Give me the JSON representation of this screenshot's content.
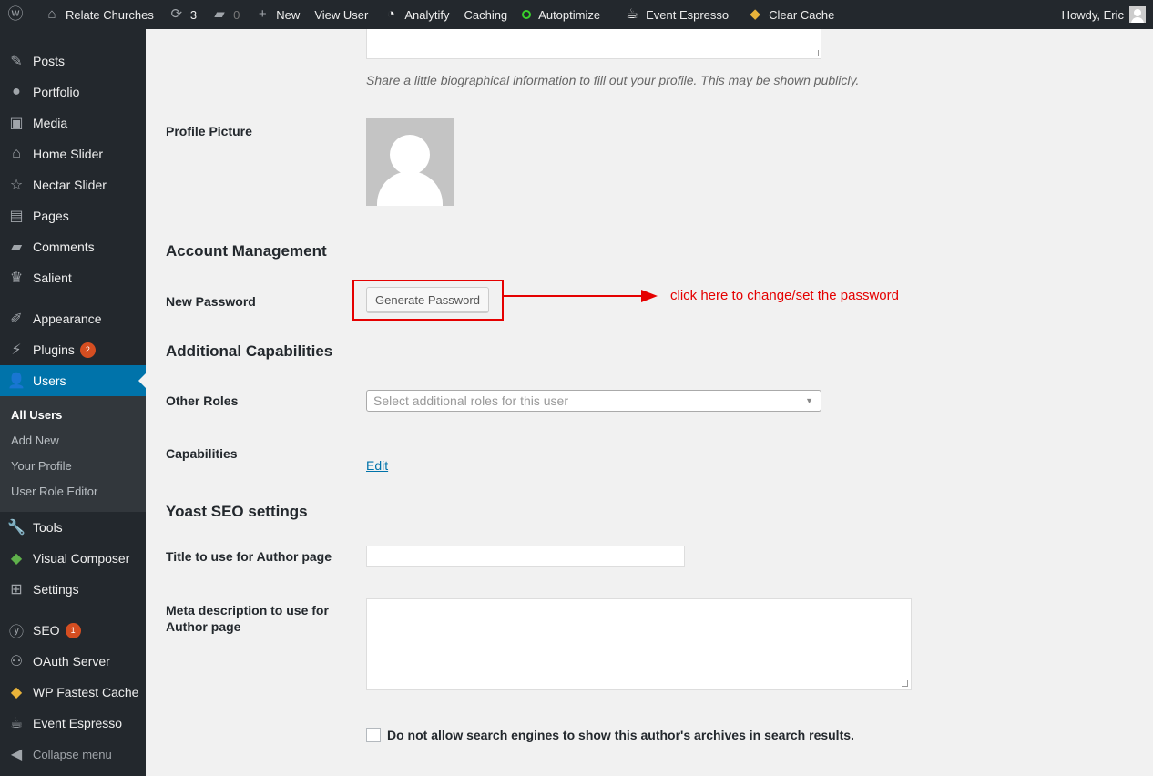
{
  "admin_bar": {
    "site_name": "Relate Churches",
    "updates_count": "3",
    "comments_count": "0",
    "new_label": "New",
    "view_user": "View User",
    "analytify": "Analytify",
    "caching": "Caching",
    "autoptimize": "Autoptimize",
    "event_espresso": "Event Espresso",
    "clear_cache": "Clear Cache",
    "howdy": "Howdy, Eric"
  },
  "sidebar": {
    "items": [
      {
        "label": "Posts",
        "icon": "pushpin-icon"
      },
      {
        "label": "Portfolio",
        "icon": "palette-icon"
      },
      {
        "label": "Media",
        "icon": "media-icon"
      },
      {
        "label": "Home Slider",
        "icon": "home-icon"
      },
      {
        "label": "Nectar Slider",
        "icon": "star-icon"
      },
      {
        "label": "Pages",
        "icon": "pages-icon"
      },
      {
        "label": "Comments",
        "icon": "comment-icon"
      },
      {
        "label": "Salient",
        "icon": "crown-icon"
      },
      {
        "label": "Appearance",
        "icon": "brush-icon"
      },
      {
        "label": "Plugins",
        "icon": "plugin-icon",
        "badge": "2"
      },
      {
        "label": "Users",
        "icon": "user-icon"
      },
      {
        "label": "Tools",
        "icon": "wrench-icon"
      },
      {
        "label": "Visual Composer",
        "icon": "visual-composer-icon"
      },
      {
        "label": "Settings",
        "icon": "settings-icon"
      },
      {
        "label": "SEO",
        "icon": "yoast-icon",
        "badge": "1"
      },
      {
        "label": "OAuth Server",
        "icon": "group-icon"
      },
      {
        "label": "WP Fastest Cache",
        "icon": "cheetah-icon"
      },
      {
        "label": "Event Espresso",
        "icon": "coffee-icon"
      }
    ],
    "submenu": [
      "All Users",
      "Add New",
      "Your Profile",
      "User Role Editor"
    ],
    "collapse": "Collapse menu"
  },
  "profile": {
    "bio_description": "Share a little biographical information to fill out your profile. This may be shown publicly.",
    "profile_picture_label": "Profile Picture",
    "account_heading": "Account Management",
    "new_password_label": "New Password",
    "generate_password": "Generate Password",
    "annotation": "click here to change/set the password",
    "capabilities_heading": "Additional Capabilities",
    "other_roles_label": "Other Roles",
    "other_roles_placeholder": "Select additional roles for this user",
    "capabilities_label": "Capabilities",
    "edit_link": "Edit",
    "yoast_heading": "Yoast SEO settings",
    "title_label": "Title to use for Author page",
    "title_value": "",
    "meta_label_1": "Meta description to use for",
    "meta_label_2": "Author page",
    "meta_value": "",
    "noindex_label": "Do not allow search engines to show this author's archives in search results."
  },
  "colors": {
    "accent": "#0073aa",
    "annotation_red": "#e50000",
    "badge": "#d54e21"
  }
}
